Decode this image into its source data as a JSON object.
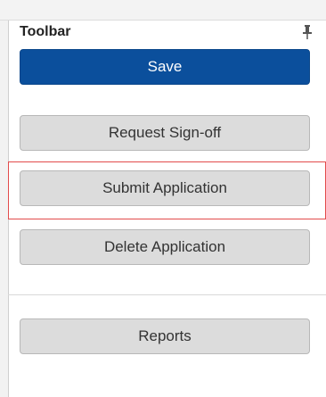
{
  "toolbar": {
    "title": "Toolbar",
    "pin_icon": "pin-icon"
  },
  "buttons": {
    "save": "Save",
    "request_signoff": "Request Sign-off",
    "submit_application": "Submit Application",
    "delete_application": "Delete Application",
    "reports": "Reports"
  },
  "colors": {
    "primary": "#0b4f9c",
    "secondary_bg": "#dcdcdc",
    "highlight": "#e24b4b"
  }
}
